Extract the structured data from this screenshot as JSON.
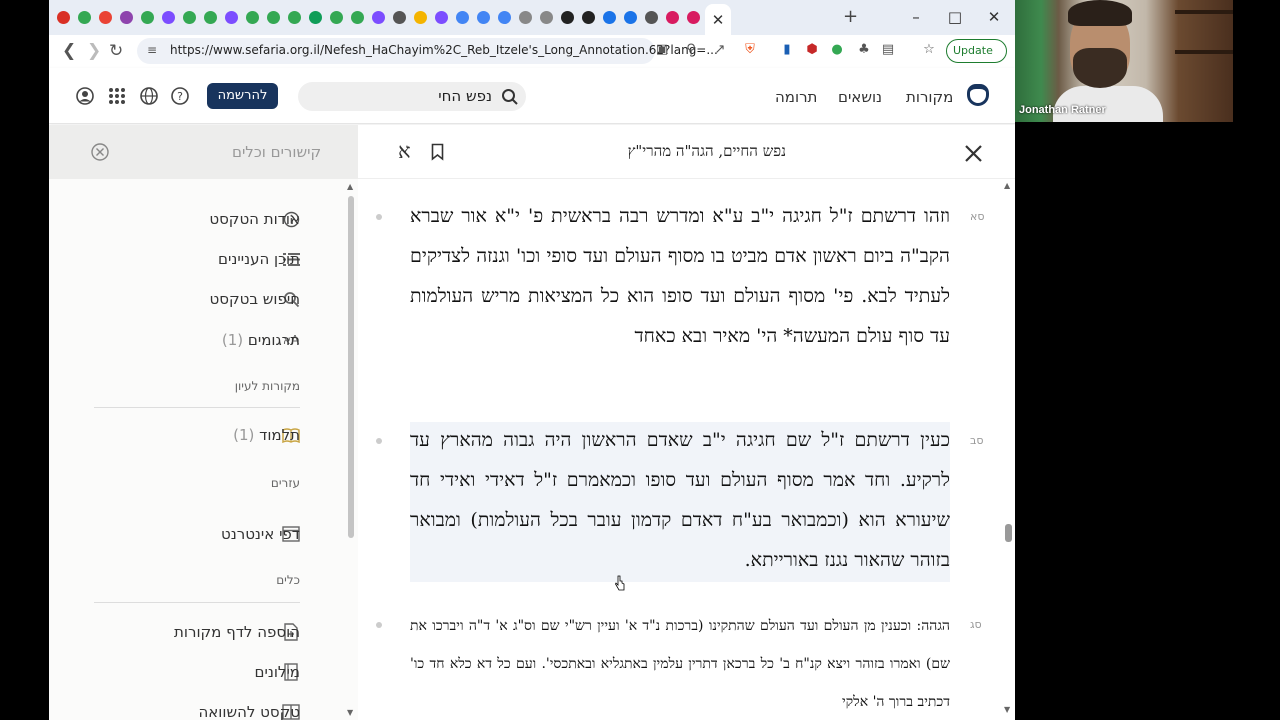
{
  "browser": {
    "url": "https://www.sefaria.org.il/Nefesh_HaChayim%2C_Reb_Itzele's_Long_Annotation.62?lang=...",
    "update_label": "Update",
    "tab_favicon_colors": [
      "#d93025",
      "#34a853",
      "#ea4335",
      "#8e44ad",
      "#34a853",
      "#7c4dff",
      "#34a853",
      "#34a853",
      "#7c4dff",
      "#34a853",
      "#34a853",
      "#34a853",
      "#0f9d58",
      "#34a853",
      "#34a853",
      "#7c4dff",
      "#555555",
      "#f4b400",
      "#7c4dff",
      "#4285f4",
      "#4285f4",
      "#4285f4",
      "#888888",
      "#888888",
      "#222222",
      "#222222",
      "#1a73e8",
      "#1a73e8",
      "#555555",
      "#d81b60",
      "#d81b60"
    ],
    "active_tab_icon": "close-icon",
    "new_tab_icon": "plus-icon"
  },
  "site": {
    "nav": {
      "texts": "מקורות",
      "topics": "נושאים",
      "donate": "תרומה"
    },
    "search_value": "נפש החי",
    "signup": "להרשמה"
  },
  "reader": {
    "title": "נפש החיים, הגה\"ה מהרי\"ץ",
    "segments": [
      {
        "number": "סא",
        "text": "וזהו דרשתם ז\"ל חגיגה י\"ב ע\"א ומדרש רבה בראשית פ' י\"א אור שברא הקב\"ה ביום ראשון אדם מביט בו מסוף העולם ועד סופי וכו' וגנזה לצדיקים לעתיד לבא. פי' מסוף העולם ועד סופו הוא כל המציאות מריש העולמות עד סוף עולם המעשה* הי' מאיר ובא כאחד"
      },
      {
        "number": "סב",
        "text": "כעין דרשתם ז\"ל שם חגיגה י\"ב שאדם הראשון היה גבוה מהארץ עד לרקיע. וחד אמר מסוף העולם ועד סופו וכמאמרם ז\"ל דאידי ואידי חד שיעורא הוא (וכמבואר בע\"ח דאדם קדמון עובר בכל העולמות) ומבואר בזוהר שהאור נגנז באורייתא."
      },
      {
        "number": "סג",
        "text": "הגהה: וכענין מן העולם ועד העולם שהתקינו (ברכות נ\"ד א' ועיין רש\"י שם וס\"ג א' ד\"ה ויברכו את שם) ואמרו בזוהר ויצא קנ\"ח ב' כל ברכאן דתרין עלמין באתגליא ובאתכסי'. ועם כל דא כלא חד כו' דכתיב ברוך ה' אלקי"
      }
    ]
  },
  "sidebar": {
    "title": "קישורים וכלים",
    "items": [
      {
        "label": "אודות הטקסט",
        "icon": "info-icon"
      },
      {
        "label": "תוכן העניינים",
        "icon": "list-icon"
      },
      {
        "label": "חיפוש בטקסט",
        "icon": "search-icon"
      },
      {
        "label": "תרגומים",
        "count": "(1)",
        "icon": "translate-icon"
      }
    ],
    "section_sources": "מקורות לעיון",
    "talmud": {
      "label": "תלמוד",
      "count": "(1)",
      "icon": "book-icon"
    },
    "section_helpers": "עזרים",
    "web_pages": {
      "label": "דפי אינטרנט",
      "icon": "browser-icon"
    },
    "section_tools": "כלים",
    "tools": [
      {
        "label": "הוספה לדף מקורות",
        "icon": "add-sheet-icon"
      },
      {
        "label": "מילונים",
        "icon": "dictionary-icon"
      },
      {
        "label": "טקסט להשוואה",
        "icon": "compare-icon"
      }
    ]
  },
  "video": {
    "participant_name": "Jonathan Ratner"
  }
}
